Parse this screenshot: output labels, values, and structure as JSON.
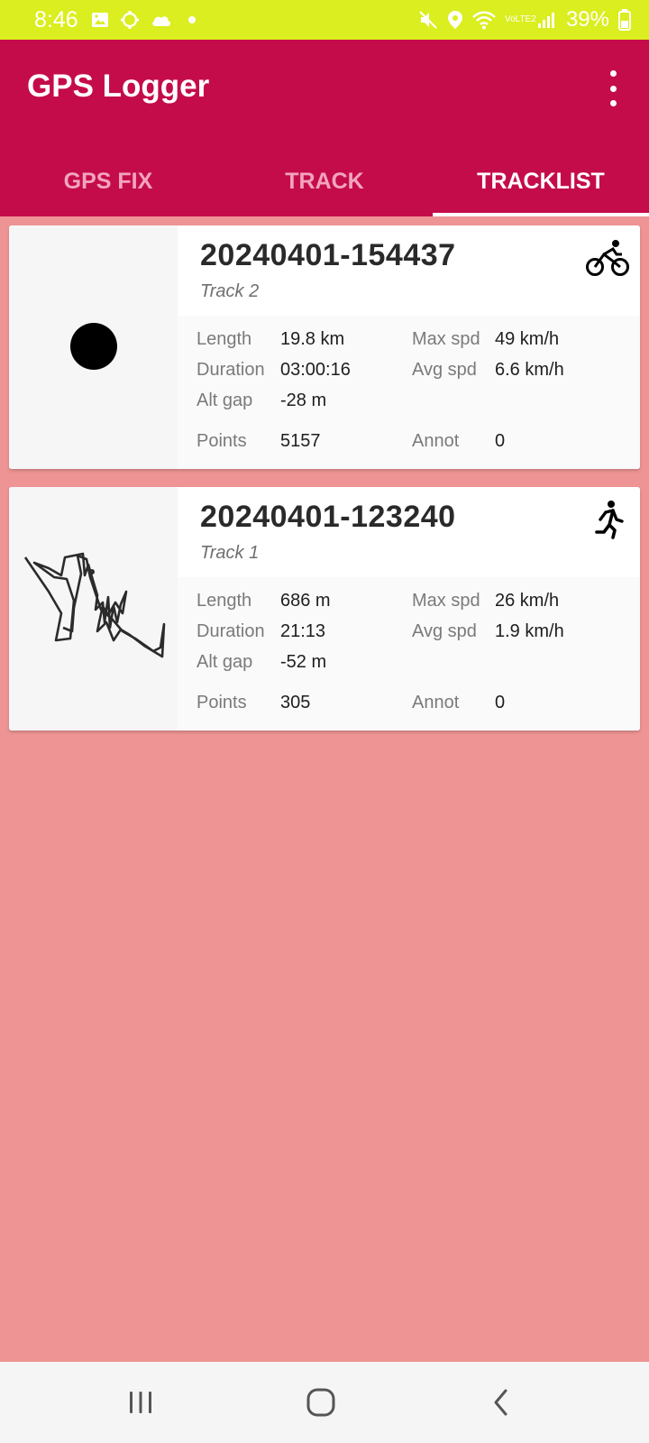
{
  "status_bar": {
    "time": "8:46",
    "battery": "39%",
    "network": "VoLTE2",
    "icons": [
      "image-icon",
      "sync-icon",
      "cloud-icon",
      "dot-icon",
      "mute-icon",
      "location-icon",
      "wifi-icon",
      "signal-icon",
      "battery-icon"
    ]
  },
  "app_bar": {
    "title": "GPS Logger",
    "menu_icon": "more-vert-icon"
  },
  "tabs": [
    {
      "label": "GPS FIX",
      "active": false
    },
    {
      "label": "TRACK",
      "active": false
    },
    {
      "label": "TRACKLIST",
      "active": true
    }
  ],
  "labels": {
    "length": "Length",
    "duration": "Duration",
    "alt_gap": "Alt gap",
    "points": "Points",
    "max_spd": "Max spd",
    "avg_spd": "Avg spd",
    "annot": "Annot"
  },
  "tracks": [
    {
      "name": "20240401-154437",
      "description": "Track 2",
      "activity": "bike-icon",
      "length": "19.8 km",
      "duration": "03:00:16",
      "alt_gap": "-28 m",
      "points": "5157",
      "max_spd": "49 km/h",
      "avg_spd": "6.6 km/h",
      "annot": "0"
    },
    {
      "name": "20240401-123240",
      "description": "Track 1",
      "activity": "run-icon",
      "length": "686 m",
      "duration": "21:13",
      "alt_gap": "-52 m",
      "points": "305",
      "max_spd": "26 km/h",
      "avg_spd": "1.9 km/h",
      "annot": "0"
    }
  ],
  "nav_bar": {
    "icons": [
      "recent-apps-icon",
      "home-icon",
      "back-icon"
    ]
  },
  "colors": {
    "status_bar": "#dbee1f",
    "app_bar": "#c50c4a",
    "background": "#ef9494"
  }
}
